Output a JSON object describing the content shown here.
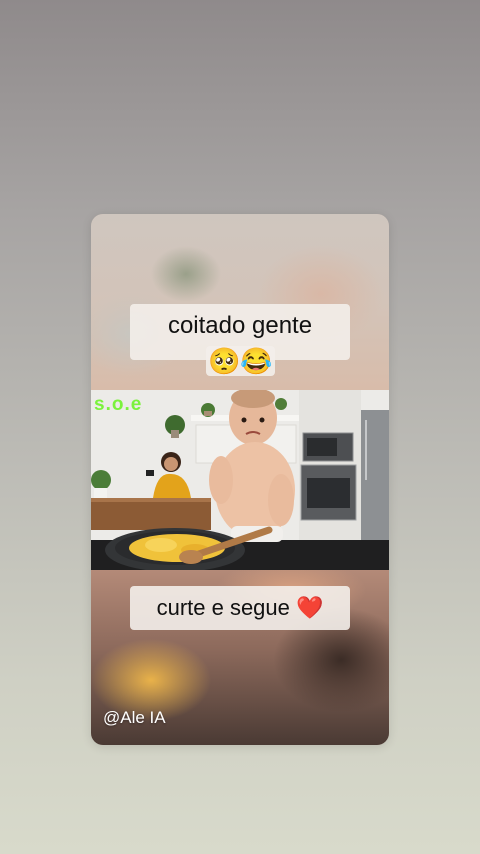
{
  "overlay": {
    "caption_top": "coitado gente",
    "caption_top_emoji": "🥺😂",
    "caption_bottom": "curte e segue",
    "caption_bottom_emoji": "❤️",
    "watermark": "s.o.e",
    "handle": "@Ale IA"
  },
  "colors": {
    "watermark": "#7bf23c",
    "heart": "#d21b2a",
    "caption_bg": "#f3eeea"
  }
}
